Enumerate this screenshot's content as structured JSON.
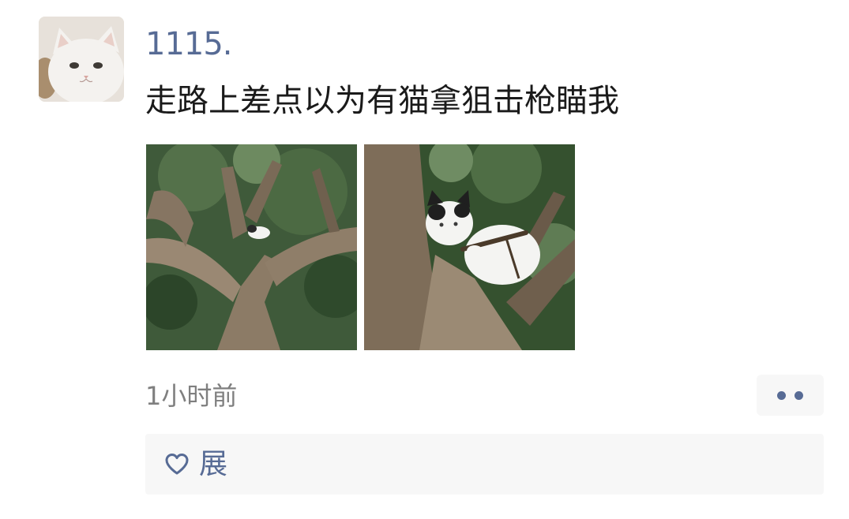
{
  "post": {
    "username": "1115.",
    "text": "走路上差点以为有猫拿狙击枪瞄我",
    "timestamp": "1小时前"
  },
  "likes": {
    "names": "展"
  },
  "colors": {
    "link": "#576b95",
    "text": "#1a1a1a",
    "meta": "#7f7f7f",
    "panel": "#f7f7f7"
  },
  "icons": {
    "like": "heart-outline-icon",
    "more": "two-dots-icon"
  }
}
